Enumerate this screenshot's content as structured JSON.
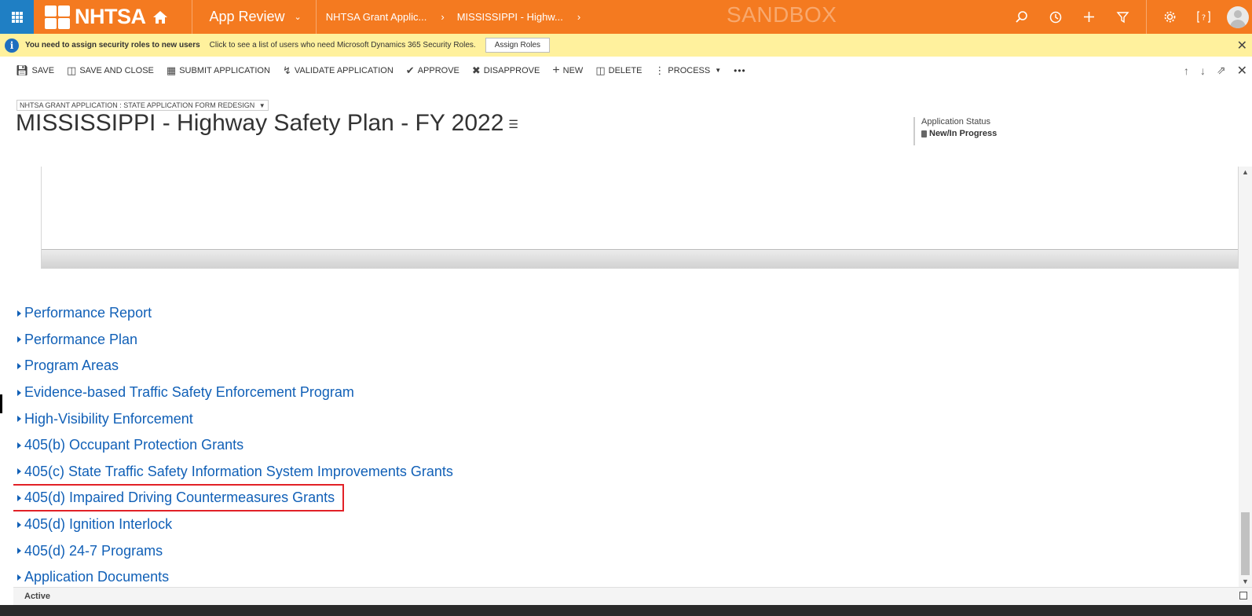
{
  "topbar": {
    "logo_text": "NHTSA",
    "app_name": "App Review",
    "breadcrumbs": [
      "NHTSA Grant Applic...",
      "MISSISSIPPI - Highw..."
    ],
    "environment": "SANDBOX",
    "icons": [
      "search-icon",
      "history-icon",
      "add-icon",
      "filter-icon",
      "settings-icon",
      "help-icon",
      "user-avatar"
    ]
  },
  "notice": {
    "title": "You need to assign security roles to new users",
    "message": "Click to see a list of users who need Microsoft Dynamics 365 Security Roles.",
    "button": "Assign Roles"
  },
  "commands": {
    "save": "SAVE",
    "save_close": "SAVE AND CLOSE",
    "submit": "SUBMIT APPLICATION",
    "validate": "VALIDATE APPLICATION",
    "approve": "APPROVE",
    "disapprove": "DISAPPROVE",
    "new": "NEW",
    "delete": "DELETE",
    "process": "PROCESS",
    "more": "•••"
  },
  "form": {
    "selector": "NHTSA GRANT APPLICATION : STATE APPLICATION FORM REDESIGN",
    "title": "MISSISSIPPI - Highway Safety Plan - FY 2022",
    "status_label": "Application Status",
    "status_value": "New/In Progress"
  },
  "sections": [
    "Performance Report",
    "Performance Plan",
    "Program Areas",
    "Evidence-based Traffic Safety Enforcement Program",
    "High-Visibility Enforcement",
    "405(b) Occupant Protection Grants",
    "405(c) State Traffic Safety Information System Improvements Grants",
    "405(d) Impaired Driving Countermeasures Grants",
    "405(d) Ignition Interlock",
    "405(d) 24-7 Programs",
    "Application Documents"
  ],
  "footer": {
    "status": "Active"
  },
  "colors": {
    "topbar": "#f47a20",
    "waffle": "#1f7fc4",
    "notice": "#fff19d",
    "link": "#1160b7",
    "highlight": "#e22127"
  }
}
